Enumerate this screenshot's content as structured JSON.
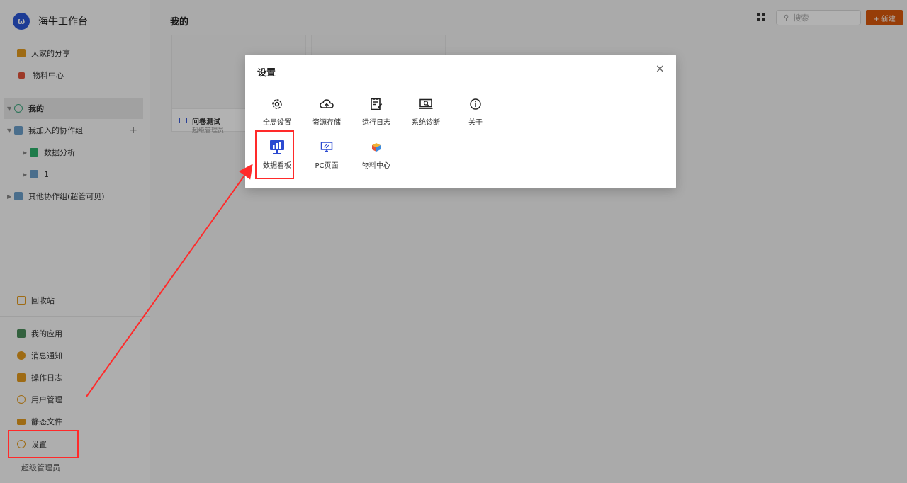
{
  "brand": {
    "logo_glyph": "ω",
    "title": "海牛工作台"
  },
  "sidebar": {
    "top_items": [
      {
        "label": "大家的分享",
        "icon": "briefcase-icon",
        "color": "#e39a1e"
      },
      {
        "label": "物料中心",
        "icon": "cube-icon",
        "color": "#e0523a"
      }
    ],
    "tree": [
      {
        "label": "我的",
        "icon": "user-icon",
        "color": "#3aa57c",
        "caret": "▼"
      },
      {
        "label": "我加入的协作组",
        "icon": "group-icon",
        "color": "#6a9ec9",
        "caret": "▼",
        "action": "+"
      },
      {
        "label": "数据分析",
        "icon": "app-icon",
        "color": "#2bb16b",
        "caret": "▶"
      },
      {
        "label": "1",
        "icon": "group-icon",
        "color": "#6a9ec9",
        "caret": "▶"
      },
      {
        "label": "其他协作组(超管可见)",
        "icon": "group-icon",
        "color": "#6a9ec9",
        "caret": "▶"
      }
    ],
    "recycle": {
      "label": "回收站",
      "icon": "trash-icon",
      "color": "#e39a1e"
    },
    "bottom_items": [
      {
        "label": "我的应用",
        "icon": "apps-icon",
        "color": "#4a8c5a"
      },
      {
        "label": "消息通知",
        "icon": "message-icon",
        "color": "#e39a1e"
      },
      {
        "label": "操作日志",
        "icon": "log-icon",
        "color": "#e39a1e"
      },
      {
        "label": "用户管理",
        "icon": "user-manage-icon",
        "color": "#e39a1e"
      },
      {
        "label": "静态文件",
        "icon": "folder-icon",
        "color": "#e39a1e"
      },
      {
        "label": "设置",
        "icon": "settings-icon",
        "color": "#e39a1e"
      }
    ],
    "user": "超级管理员"
  },
  "header": {
    "title": "我的",
    "search_placeholder": "搜索",
    "new_label": "+ 新建"
  },
  "cards": [
    {
      "name": "问卷测试",
      "owner": "超级管理员"
    }
  ],
  "modal": {
    "title": "设置",
    "close": "×",
    "tiles": [
      {
        "label": "全局设置",
        "icon": "gear-icon"
      },
      {
        "label": "资源存储",
        "icon": "cloud-icon"
      },
      {
        "label": "运行日志",
        "icon": "log-edit-icon"
      },
      {
        "label": "系统诊断",
        "icon": "diagnose-icon"
      },
      {
        "label": "关于",
        "icon": "info-icon"
      },
      {
        "label": "数据看板",
        "icon": "dashboard-icon"
      },
      {
        "label": "PC页面",
        "icon": "monitor-icon"
      },
      {
        "label": "物料中心",
        "icon": "material-icon"
      }
    ]
  },
  "colors": {
    "accent": "#d9580c",
    "highlight": "#ff2a2a",
    "brand": "#2a57d6"
  }
}
